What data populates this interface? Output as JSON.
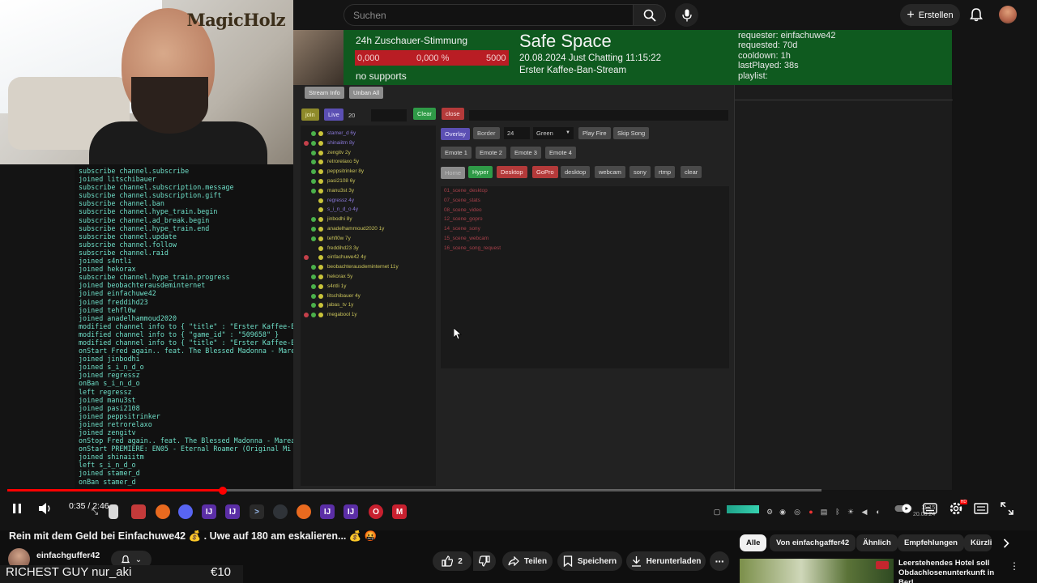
{
  "search": {
    "placeholder": "Suchen"
  },
  "header": {
    "create_label": "Erstellen"
  },
  "webcam": {
    "logo": "MagicHolz"
  },
  "terminal": {
    "lines": [
      "subscribe channel.subscribe",
      "joined litschibauer",
      "subscribe channel.subscription.message",
      "subscribe channel.subscription.gift",
      "subscribe channel.ban",
      "subscribe channel.hype_train.begin",
      "subscribe channel.ad_break.begin",
      "subscribe channel.hype_train.end",
      "subscribe channel.update",
      "subscribe channel.follow",
      "subscribe channel.raid",
      "joined s4ntli",
      "joined hekorax",
      "subscribe channel.hype_train.progress",
      "joined beobachterausdeminternet",
      "joined einfachuwe42",
      "joined freddihd23",
      "joined tehfl0w",
      "joined anadelhammoud2020",
      "modified channel info to { \"title\" : \"Erster Kaffee-B",
      "modified channel info to { \"game_id\" : \"509658\" }",
      "modified channel info to { \"title\" : \"Erster Kaffee-B",
      "onStart Fred again.. feat. The Blessed Madonna - Mare",
      "joined jinbodhi",
      "joined s_i_n_d_o",
      "joined regressz",
      "onBan s_i_n_d_o",
      "left regressz",
      "joined manu3st",
      "joined pasi2108",
      "joined peppsitrinker",
      "joined retrorelaxo",
      "joined zengitv",
      "onStop Fred again.. feat. The Blessed Madonna - Marea",
      "onStart PREMIERE:  EN05 - Eternal Roamer (Original Mi",
      "joined shinaiitm",
      "left s_i_n_d_o",
      "joined stamer_d",
      "onBan stamer_d"
    ]
  },
  "panel": {
    "mood_title": "24h Zuschauer-Stimmung",
    "mood_value": "0,000",
    "mood_percent": "0,000 %",
    "mood_max": "5000",
    "supports": "no supports",
    "stream_title": "Safe Space",
    "stream_meta": "20.08.2024 Just Chatting 11:15:22",
    "stream_subtitle": "Erster Kaffee-Ban-Stream",
    "requester": "requester: einfachuwe42",
    "requested": "requested: 70d",
    "cooldown": "cooldown: 1h",
    "last_played": "lastPlayed: 38s",
    "playlist": "playlist:",
    "buttons": {
      "stream_info": "Stream Info",
      "unban_all": "Unban All",
      "join": "join",
      "live": "Live",
      "live_count": "20",
      "clear": "Clear",
      "close": "close",
      "overlay": "Overlay",
      "border": "Border",
      "border_value": "24",
      "color": "Green",
      "play_fire": "Play Fire",
      "skip_song": "Skip Song",
      "emote1": "Emote 1",
      "emote2": "Emote 2",
      "emote3": "Emote 3",
      "emote4": "Emote 4",
      "home": "Home",
      "hyper": "Hyper",
      "desktop": "Desktop",
      "gopro": "GoPro",
      "desktop2": "desktop",
      "webcam": "webcam",
      "sony": "sony",
      "rtmp": "rtmp",
      "clear2": "clear"
    },
    "users": [
      {
        "name": "stamer_d  6y",
        "dots": [
          "",
          "g",
          "y"
        ],
        "violet": true
      },
      {
        "name": "shinaiitm  8y",
        "dots": [
          "r",
          "g",
          "y"
        ],
        "violet": true
      },
      {
        "name": "zengitv  2y",
        "dots": [
          "",
          "g",
          "y"
        ],
        "violet": false
      },
      {
        "name": "retrorelaxo  5y",
        "dots": [
          "",
          "g",
          "y"
        ],
        "violet": false
      },
      {
        "name": "peppsitrinker  8y",
        "dots": [
          "",
          "g",
          "y"
        ],
        "violet": false
      },
      {
        "name": "pasi2108  6y",
        "dots": [
          "",
          "g",
          "y"
        ],
        "violet": false
      },
      {
        "name": "manu3st  3y",
        "dots": [
          "",
          "g",
          "y"
        ],
        "violet": false
      },
      {
        "name": "regressz  4y",
        "dots": [
          "",
          "",
          "y"
        ],
        "violet": true
      },
      {
        "name": "s_i_n_d_o  4y",
        "dots": [
          "",
          "",
          "y"
        ],
        "violet": true
      },
      {
        "name": "jinbodhi  8y",
        "dots": [
          "",
          "g",
          "y"
        ],
        "violet": false
      },
      {
        "name": "anadelhammoud2020  1y",
        "dots": [
          "",
          "g",
          "y"
        ],
        "violet": false
      },
      {
        "name": "tehfl0w  7y",
        "dots": [
          "",
          "g",
          "y"
        ],
        "violet": false
      },
      {
        "name": "freddihd23  3y",
        "dots": [
          "",
          "",
          "y"
        ],
        "violet": false
      },
      {
        "name": "einfachuwe42  4y",
        "dots": [
          "r",
          "",
          "y"
        ],
        "violet": false
      },
      {
        "name": "beobachterausdeminternet  11y",
        "dots": [
          "",
          "g",
          "y"
        ],
        "violet": false
      },
      {
        "name": "hekorax  5y",
        "dots": [
          "",
          "g",
          "y"
        ],
        "violet": false
      },
      {
        "name": "s4ntli  1y",
        "dots": [
          "",
          "g",
          "y"
        ],
        "violet": false
      },
      {
        "name": "litschibauer  4y",
        "dots": [
          "",
          "g",
          "y"
        ],
        "violet": false
      },
      {
        "name": "jabas_tv  1y",
        "dots": [
          "",
          "g",
          "y"
        ],
        "violet": false
      },
      {
        "name": "megabool  1y",
        "dots": [
          "r",
          "g",
          "y"
        ],
        "violet": false
      }
    ],
    "scenes": [
      "01_scene_desktop",
      "07_scene_stats",
      "08_scene_video",
      "12_scene_gopro",
      "14_scene_sony",
      "15_scene_webcam",
      "16_scene_song_request"
    ]
  },
  "player": {
    "time": "0:35 / 2:46",
    "progress_fraction": 0.21,
    "clock": "11:15",
    "date": "20.08.24"
  },
  "video": {
    "title": "Rein mit dem Geld bei Einfachuwe42 💰 . Uwe auf 180 am eskalieren... 💰 🤬",
    "channel": "einfachguffer42",
    "likes": "2",
    "share": "Teilen",
    "save": "Speichern",
    "download": "Herunterladen"
  },
  "overlay": {
    "name": "RICHEST GUY nur_aki",
    "amount": "€10"
  },
  "chips": [
    "Alle",
    "Von einfachgaffer42",
    "Ähnlich",
    "Empfehlungen",
    "Kürzlich"
  ],
  "recommendation": {
    "title": "Leerstehendes Hotel soll Obdachlosenunterkunft in Berl..."
  },
  "colors": {
    "accent": "#ff0000",
    "panel_green": "#0f5a1f",
    "mood_red": "#b91d24"
  }
}
